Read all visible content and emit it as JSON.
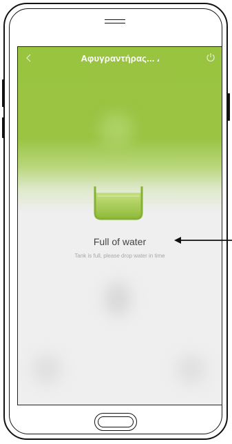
{
  "app": {
    "title": "Αφυγραντήρας..."
  },
  "icons": {
    "back": "chevron-left-icon",
    "power": "power-icon",
    "tank": "water-tank-icon"
  },
  "status": {
    "title": "Full of water",
    "subtitle": "Tank is full, please drop water in time"
  },
  "colors": {
    "accent": "#99c440",
    "background": "#efefef"
  }
}
